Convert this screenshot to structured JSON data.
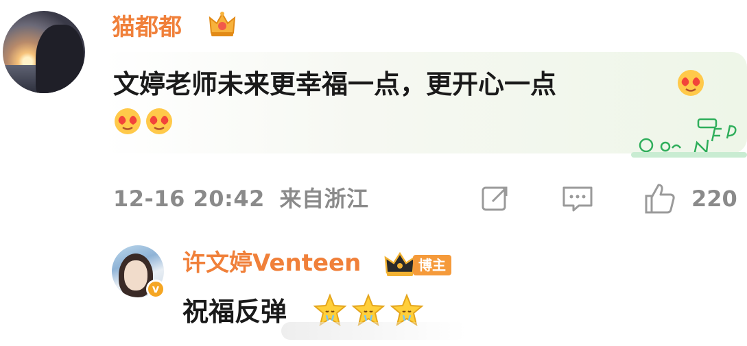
{
  "comment": {
    "username": "猫都都",
    "text": "文婷老师未来更幸福一点，更开心一点",
    "timestamp": "12-16 20:42",
    "location": "来自浙江",
    "like_count": "220",
    "emojis": [
      "heart-eyes-emoji",
      "heart-eyes-emoji",
      "heart-eyes-emoji"
    ],
    "sticker": "INFP"
  },
  "reply": {
    "username": "许文婷Venteen",
    "role_badge": "博主",
    "text": "祝福反弹",
    "emojis": [
      "star-emoji",
      "star-emoji",
      "star-emoji"
    ]
  },
  "icons": {
    "share": "share-icon",
    "comment": "comment-icon",
    "like": "thumbs-up-icon",
    "crown": "crown-icon",
    "verified": "verified-icon"
  },
  "colors": {
    "username": "#f0803a",
    "meta_text": "#8a8a8a",
    "badge": "#f59a3a"
  }
}
